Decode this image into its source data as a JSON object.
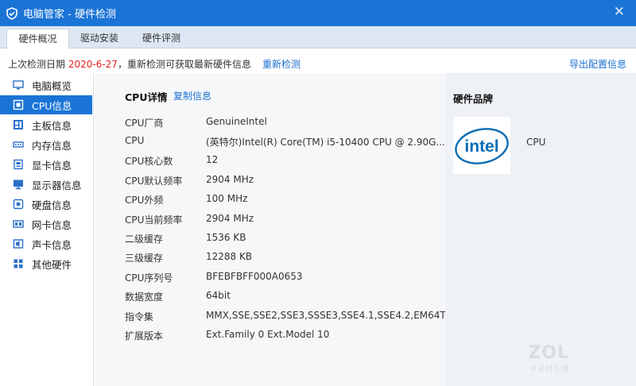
{
  "window": {
    "title": "电脑管家 - 硬件检测",
    "close_glyph": "✕"
  },
  "tabs": [
    {
      "label": "硬件概况",
      "active": true
    },
    {
      "label": "驱动安装",
      "active": false
    },
    {
      "label": "硬件评测",
      "active": false
    }
  ],
  "infobar": {
    "prefix": "上次检测日期 ",
    "date": "2020-6-27",
    "suffix": "，重新检测可获取最新硬件信息",
    "recheck_label": "重新检测",
    "export_label": "导出配置信息"
  },
  "sidebar": {
    "items": [
      {
        "label": "电脑概览",
        "icon": "monitor-overview-icon",
        "active": false
      },
      {
        "label": "CPU信息",
        "icon": "cpu-icon",
        "active": true
      },
      {
        "label": "主板信息",
        "icon": "motherboard-icon",
        "active": false
      },
      {
        "label": "内存信息",
        "icon": "memory-icon",
        "active": false
      },
      {
        "label": "显卡信息",
        "icon": "graphics-card-icon",
        "active": false
      },
      {
        "label": "显示器信息",
        "icon": "display-icon",
        "active": false
      },
      {
        "label": "硬盘信息",
        "icon": "disk-icon",
        "active": false
      },
      {
        "label": "网卡信息",
        "icon": "network-card-icon",
        "active": false
      },
      {
        "label": "声卡信息",
        "icon": "sound-card-icon",
        "active": false
      },
      {
        "label": "其他硬件",
        "icon": "other-hardware-icon",
        "active": false
      }
    ]
  },
  "main": {
    "heading": "CPU详情",
    "copy_label": "复制信息",
    "rows": [
      {
        "key": "CPU厂商",
        "value": "GenuineIntel"
      },
      {
        "key": "CPU",
        "value": "(英特尔)Intel(R) Core(TM) i5-10400 CPU @ 2.90G..."
      },
      {
        "key": "CPU核心数",
        "value": "12"
      },
      {
        "key": "CPU默认频率",
        "value": "2904 MHz"
      },
      {
        "key": "CPU外频",
        "value": "100 MHz"
      },
      {
        "key": "CPU当前频率",
        "value": "2904 MHz"
      },
      {
        "key": "二级缓存",
        "value": "1536 KB"
      },
      {
        "key": "三级缓存",
        "value": "12288 KB"
      },
      {
        "key": "CPU序列号",
        "value": "BFEBFBFF000A0653"
      },
      {
        "key": "数据宽度",
        "value": "64bit"
      },
      {
        "key": "指令集",
        "value": "MMX,SSE,SSE2,SSE3,SSSE3,SSE4.1,SSE4.2,EM64T"
      },
      {
        "key": "扩展版本",
        "value": "Ext.Family 0  Ext.Model 10"
      }
    ]
  },
  "brand": {
    "title": "硬件品牌",
    "logo_text": "intel",
    "item_label": "CPU"
  },
  "watermark": {
    "text": "ZOL",
    "subtext": "中关村在线"
  },
  "colors": {
    "accent": "#1a74d6",
    "link": "#1a6fd1",
    "date_red": "#e02020"
  }
}
